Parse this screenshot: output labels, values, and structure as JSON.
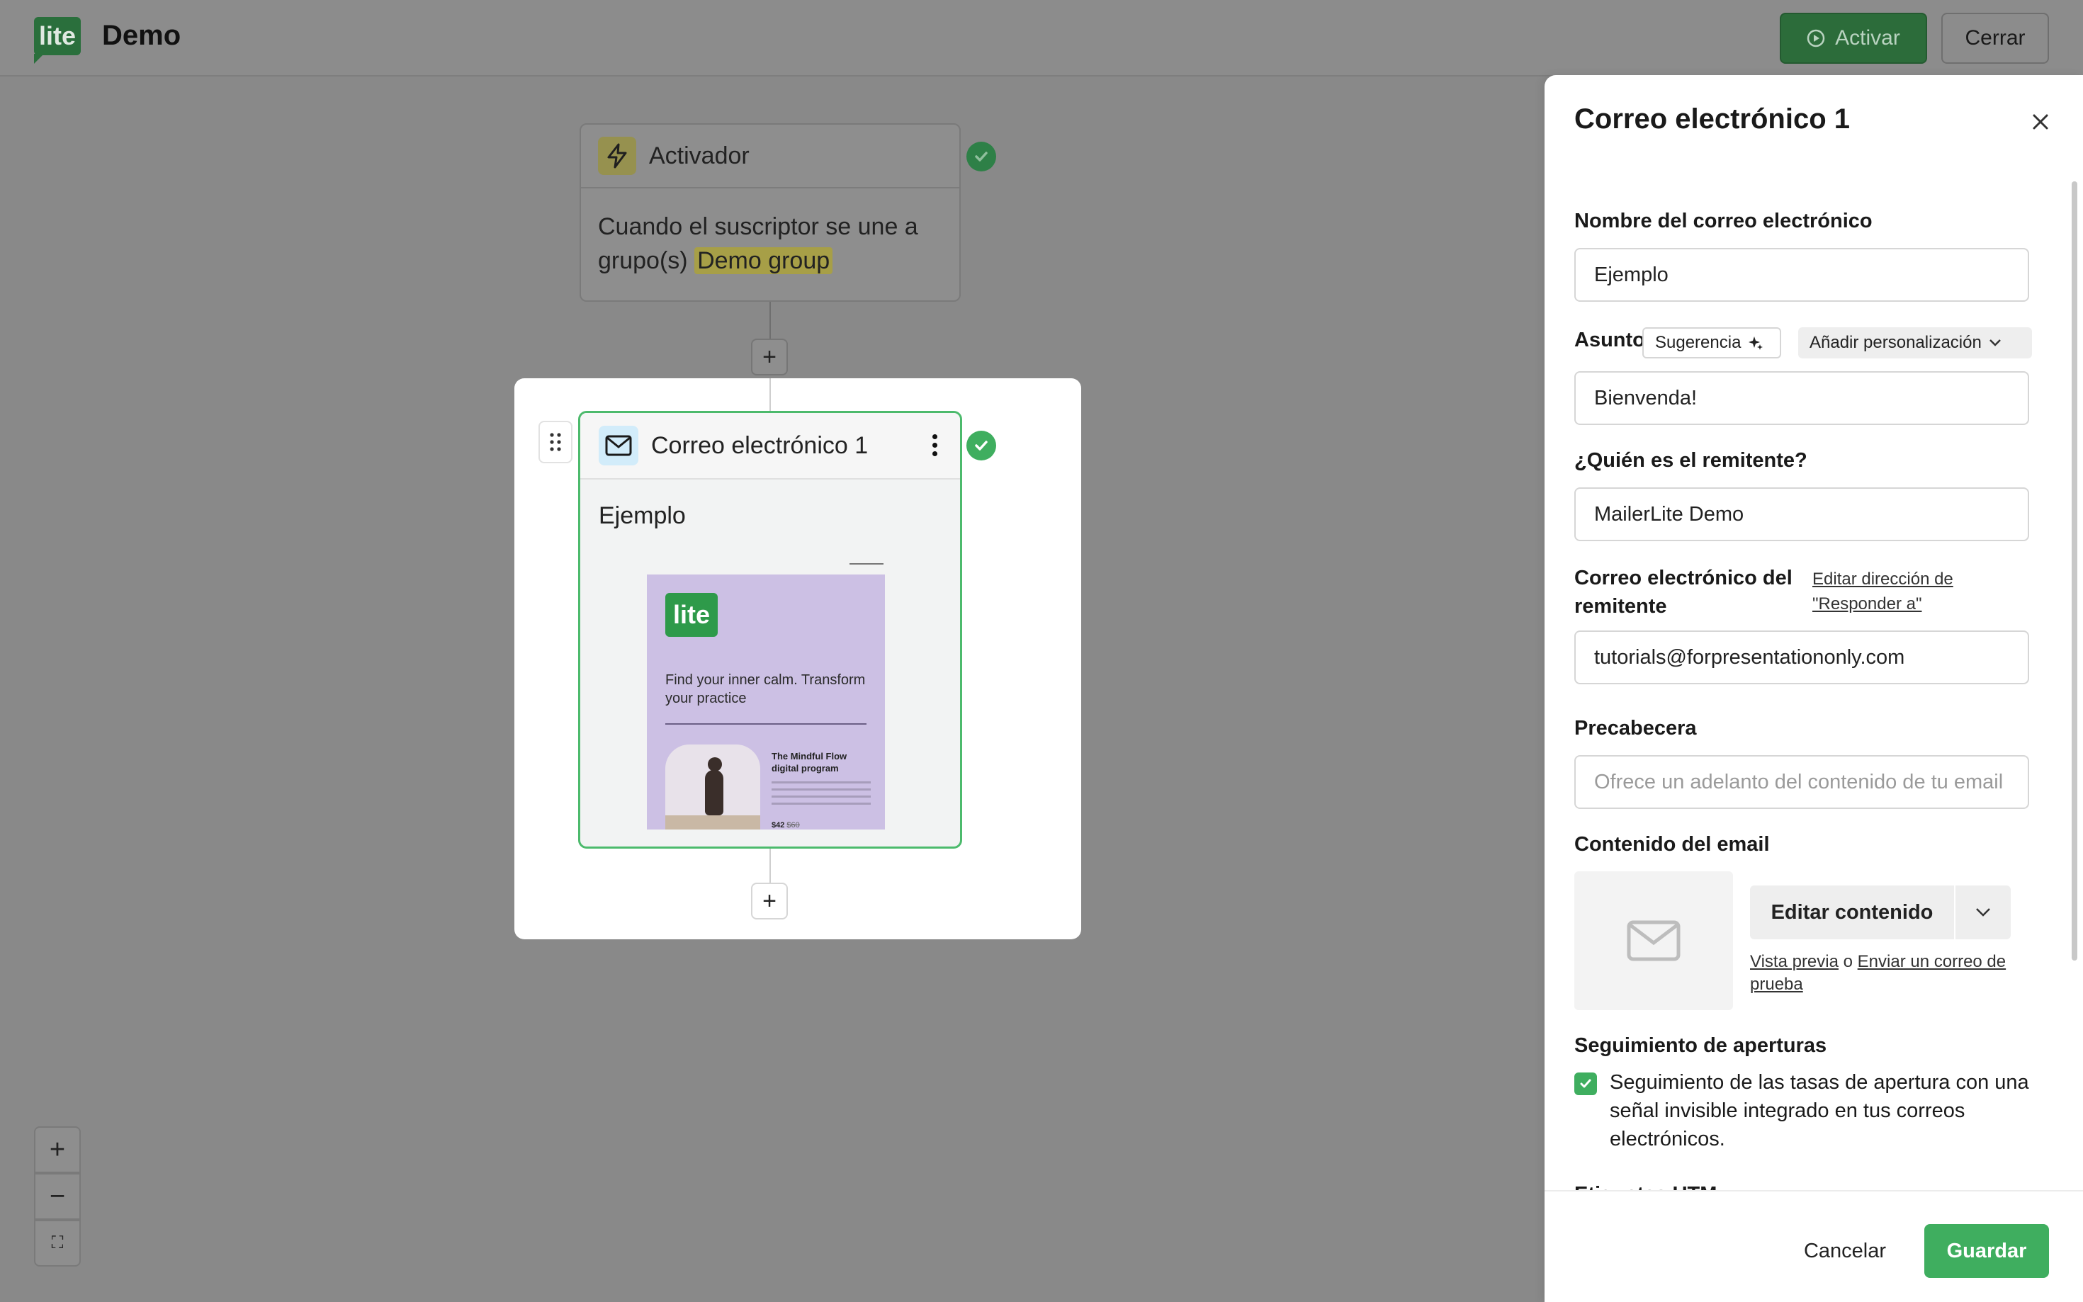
{
  "header": {
    "logo_text": "lite",
    "title": "Demo",
    "activate_label": "Activar",
    "close_label": "Cerrar"
  },
  "workflow": {
    "trigger": {
      "title": "Activador",
      "description": "Cuando el suscriptor se une a grupo(s)",
      "group": "Demo group"
    },
    "email_step": {
      "title": "Correo electrónico 1",
      "subtitle": "Ejemplo",
      "thumbnail": {
        "logo_text": "lite",
        "headline": "Find your inner calm. Transform your practice",
        "program_title": "The Mindful Flow digital program",
        "price": "$42",
        "old_price": "$60"
      }
    },
    "plus_label": "+"
  },
  "zoom": {
    "in": "+",
    "out": "−",
    "fit": "⛶"
  },
  "drawer": {
    "title": "Correo electrónico 1",
    "email_name": {
      "label": "Nombre del correo electrónico",
      "value": "Ejemplo"
    },
    "subject": {
      "label": "Asunto",
      "suggest_label": "Sugerencia",
      "personalize_label": "Añadir personalización",
      "value": "Bienvenda!"
    },
    "sender": {
      "label": "¿Quién es el remitente?",
      "value": "MailerLite Demo"
    },
    "sender_email": {
      "label": "Correo electrónico del remitente",
      "reply_link": "Editar dirección de \"Responder a\"",
      "value": "tutorials@forpresentationonly.com"
    },
    "preheader": {
      "label": "Precabecera",
      "placeholder": "Ofrece un adelanto del contenido de tu email"
    },
    "content": {
      "label": "Contenido del email",
      "edit_label": "Editar contenido",
      "preview_link": "Vista previa",
      "or_text": "o",
      "test_link": "Enviar un correo de prueba"
    },
    "tracking": {
      "label": "Seguimiento de aperturas",
      "checkbox_text": "Seguimiento de las tasas de apertura con una señal invisible integrado en tus correos electrónicos.",
      "checked": true
    },
    "utm_label": "Etiquetas UTM",
    "footer": {
      "cancel_label": "Cancelar",
      "save_label": "Guardar"
    }
  },
  "colors": {
    "brand_green": "#3fae5f",
    "focus_border": "#4cba6c",
    "overlay_gray": "#898989"
  }
}
